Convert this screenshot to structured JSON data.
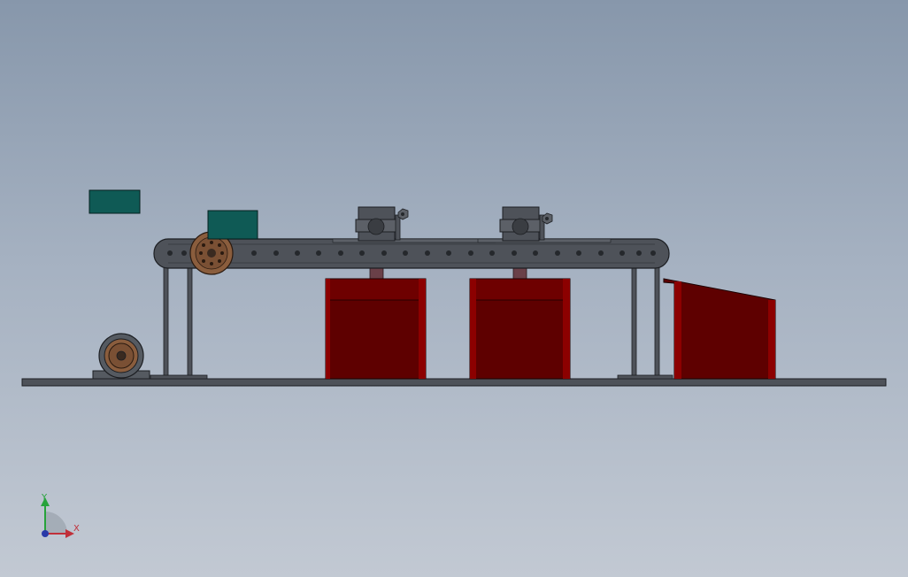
{
  "viewport": {
    "background_top": "#8797ab",
    "background_bottom": "#c2c9d3"
  },
  "model": {
    "frame_color": "#4e5259",
    "frame_edge_color": "#1c1e22",
    "bin_color": "#5e0000",
    "bin_highlight_color": "#8c0000",
    "box_color": "#0f5a55",
    "pulley_color": "#8a5d3d",
    "motor_color": "#555a61"
  },
  "triad": {
    "x_label": "X",
    "y_label": "Y",
    "x_color": "#c0303a",
    "y_color": "#27a33b",
    "z_color": "#2a3aa8"
  }
}
